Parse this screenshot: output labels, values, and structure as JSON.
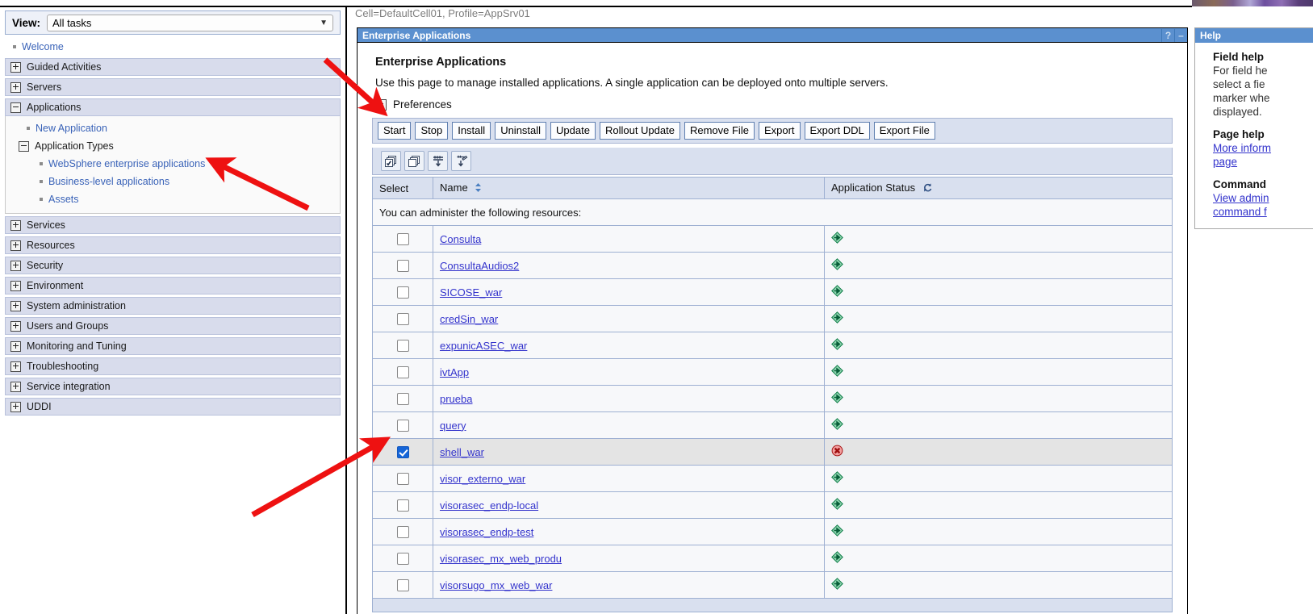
{
  "breadcrumb": "Cell=DefaultCell01, Profile=AppSrv01",
  "sidebar": {
    "view_label": "View:",
    "view_value": "All tasks",
    "welcome": "Welcome",
    "groups": [
      {
        "label": "Guided Activities",
        "state": "collapsed"
      },
      {
        "label": "Servers",
        "state": "collapsed"
      },
      {
        "label": "Applications",
        "state": "expanded"
      },
      {
        "label": "Services",
        "state": "collapsed"
      },
      {
        "label": "Resources",
        "state": "collapsed"
      },
      {
        "label": "Security",
        "state": "collapsed"
      },
      {
        "label": "Environment",
        "state": "collapsed"
      },
      {
        "label": "System administration",
        "state": "collapsed"
      },
      {
        "label": "Users and Groups",
        "state": "collapsed"
      },
      {
        "label": "Monitoring and Tuning",
        "state": "collapsed"
      },
      {
        "label": "Troubleshooting",
        "state": "collapsed"
      },
      {
        "label": "Service integration",
        "state": "collapsed"
      },
      {
        "label": "UDDI",
        "state": "collapsed"
      }
    ],
    "applications_children": {
      "new_application": "New Application",
      "application_types": "Application Types",
      "types": [
        "WebSphere enterprise applications",
        "Business-level applications",
        "Assets"
      ]
    }
  },
  "portlet": {
    "title": "Enterprise Applications",
    "help_icon": "?",
    "minimize_icon": "–",
    "heading": "Enterprise Applications",
    "description": "Use this page to manage installed applications. A single application can be deployed onto multiple servers.",
    "preferences": "Preferences",
    "buttons": [
      "Start",
      "Stop",
      "Install",
      "Uninstall",
      "Update",
      "Rollout Update",
      "Remove File",
      "Export",
      "Export DDL",
      "Export File"
    ],
    "icon_buttons": [
      "select-all-icon",
      "deselect-all-icon",
      "show-filter-icon",
      "clear-filter-icon"
    ]
  },
  "table": {
    "headers": {
      "select": "Select",
      "name": "Name",
      "status": "Application Status"
    },
    "banner": "You can administer the following resources:",
    "rows": [
      {
        "name": "Consulta",
        "status": "started",
        "checked": false
      },
      {
        "name": "ConsultaAudios2",
        "status": "started",
        "checked": false
      },
      {
        "name": "SICOSE_war",
        "status": "started",
        "checked": false
      },
      {
        "name": "credSin_war",
        "status": "started",
        "checked": false
      },
      {
        "name": "expunicASEC_war",
        "status": "started",
        "checked": false
      },
      {
        "name": "ivtApp",
        "status": "started",
        "checked": false
      },
      {
        "name": "prueba",
        "status": "started",
        "checked": false
      },
      {
        "name": "query",
        "status": "started",
        "checked": false
      },
      {
        "name": "shell_war",
        "status": "stopped",
        "checked": true
      },
      {
        "name": "visor_externo_war",
        "status": "started",
        "checked": false
      },
      {
        "name": "visorasec_endp-local",
        "status": "started",
        "checked": false
      },
      {
        "name": "visorasec_endp-test",
        "status": "started",
        "checked": false
      },
      {
        "name": "visorasec_mx_web_produ",
        "status": "started",
        "checked": false
      },
      {
        "name": "visorsugo_mx_web_war",
        "status": "started",
        "checked": false
      }
    ]
  },
  "help": {
    "title": "Help",
    "field_help_heading": "Field help",
    "field_help_lines": [
      "For field he",
      "select a fie",
      "marker whe",
      "displayed."
    ],
    "page_help_heading": "Page help",
    "page_help_links": [
      "More inform",
      "page"
    ],
    "command_heading": "Command",
    "command_links": [
      "View admin",
      "command f"
    ]
  },
  "colors": {
    "accent": "#5b90cf",
    "link": "#3333cc",
    "nav_link": "#3a63b8",
    "group_bg": "#d8dcec",
    "toolbar_bg": "#d9e0ef",
    "status_started": "#0f9d58",
    "status_stopped": "#d93025",
    "annotation": "#ee1111"
  }
}
